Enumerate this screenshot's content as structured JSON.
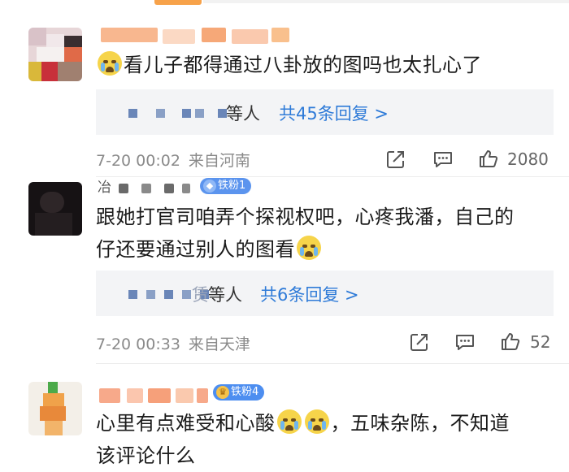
{
  "comments": [
    {
      "text": "看儿子都得通过八卦放的图吗也太扎心了",
      "reply_suffix": "等人",
      "reply_more": "共45条回复 >",
      "time": "7-20 00:02",
      "location": "来自河南",
      "likes": "2080"
    },
    {
      "username_first_char": "冶",
      "badge": "铁粉1",
      "text_line1": "跟她打官司咱弄个探视权吧，心疼我潘，自己的",
      "text_line2": "仔还要通过别人的图看",
      "reply_partial": "赁",
      "reply_suffix": "等人",
      "reply_more": "共6条回复 >",
      "time": "7-20 00:33",
      "location": "来自天津",
      "likes": "52"
    },
    {
      "badge": "铁粉4",
      "text_line1a": "心里有点难受和心酸",
      "text_line1b": "，五味杂陈，不知道",
      "text_line2": "该评论什么"
    }
  ],
  "icons": {
    "forward": "share-icon",
    "comment": "comment-icon",
    "like": "thumbs-up-icon",
    "emoji": "crying-face-icon"
  },
  "colors": {
    "link": "#2f7bd8",
    "badge_bg": "#4d8ef0",
    "meta": "#8a8a8a"
  }
}
